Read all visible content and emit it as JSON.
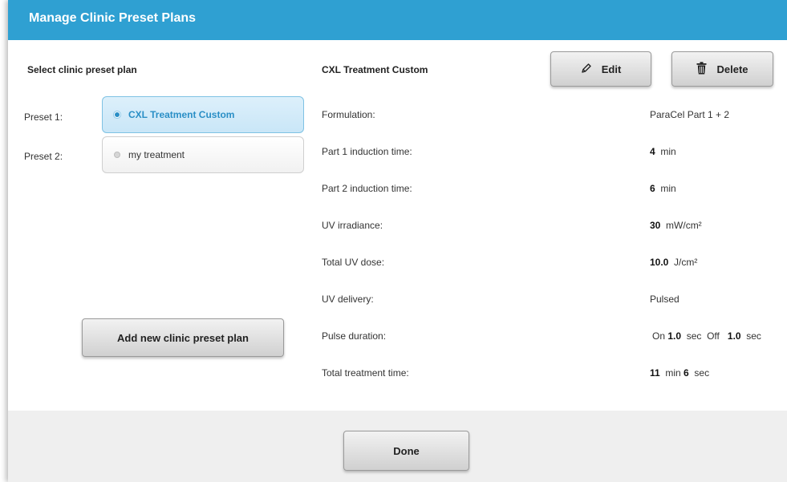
{
  "header": {
    "title": "Manage Clinic Preset Plans"
  },
  "left_panel": {
    "heading": "Select clinic preset plan",
    "presets": [
      {
        "label": "Preset 1:",
        "name": "CXL Treatment Custom",
        "selected": true
      },
      {
        "label": "Preset 2:",
        "name": "my treatment",
        "selected": false
      }
    ],
    "add_button": "Add new clinic preset plan"
  },
  "detail": {
    "title": "CXL Treatment Custom",
    "edit_button": "Edit",
    "delete_button": "Delete",
    "formulation": {
      "label": "Formulation:",
      "value": "ParaCel Part 1 + 2"
    },
    "part1": {
      "label": "Part 1 induction time:",
      "value": "4",
      "unit": "min"
    },
    "part2": {
      "label": "Part 2 induction time:",
      "value": "6",
      "unit": "min"
    },
    "irradiance": {
      "label": "UV irradiance:",
      "value": "30",
      "unit": "mW/cm²"
    },
    "dose": {
      "label": "Total UV dose:",
      "value": "10.0",
      "unit": "J/cm²"
    },
    "delivery": {
      "label": "UV delivery:",
      "value": "Pulsed"
    },
    "pulse": {
      "label": "Pulse duration:",
      "on_label": "On",
      "on_value": "1.0",
      "on_unit": "sec",
      "off_label": "Off",
      "off_value": "1.0",
      "off_unit": "sec"
    },
    "total_time": {
      "label": "Total treatment time:",
      "min_value": "11",
      "min_unit": "min",
      "sec_value": "6",
      "sec_unit": "sec"
    }
  },
  "footer": {
    "done_button": "Done"
  },
  "colors": {
    "header": "#2fa0d2",
    "selected_text": "#2a8fc6",
    "selected_bg": "#d2ebf9",
    "footer_bg": "#efefef"
  },
  "icons": {
    "edit": "pencil-icon",
    "delete": "trash-icon"
  }
}
